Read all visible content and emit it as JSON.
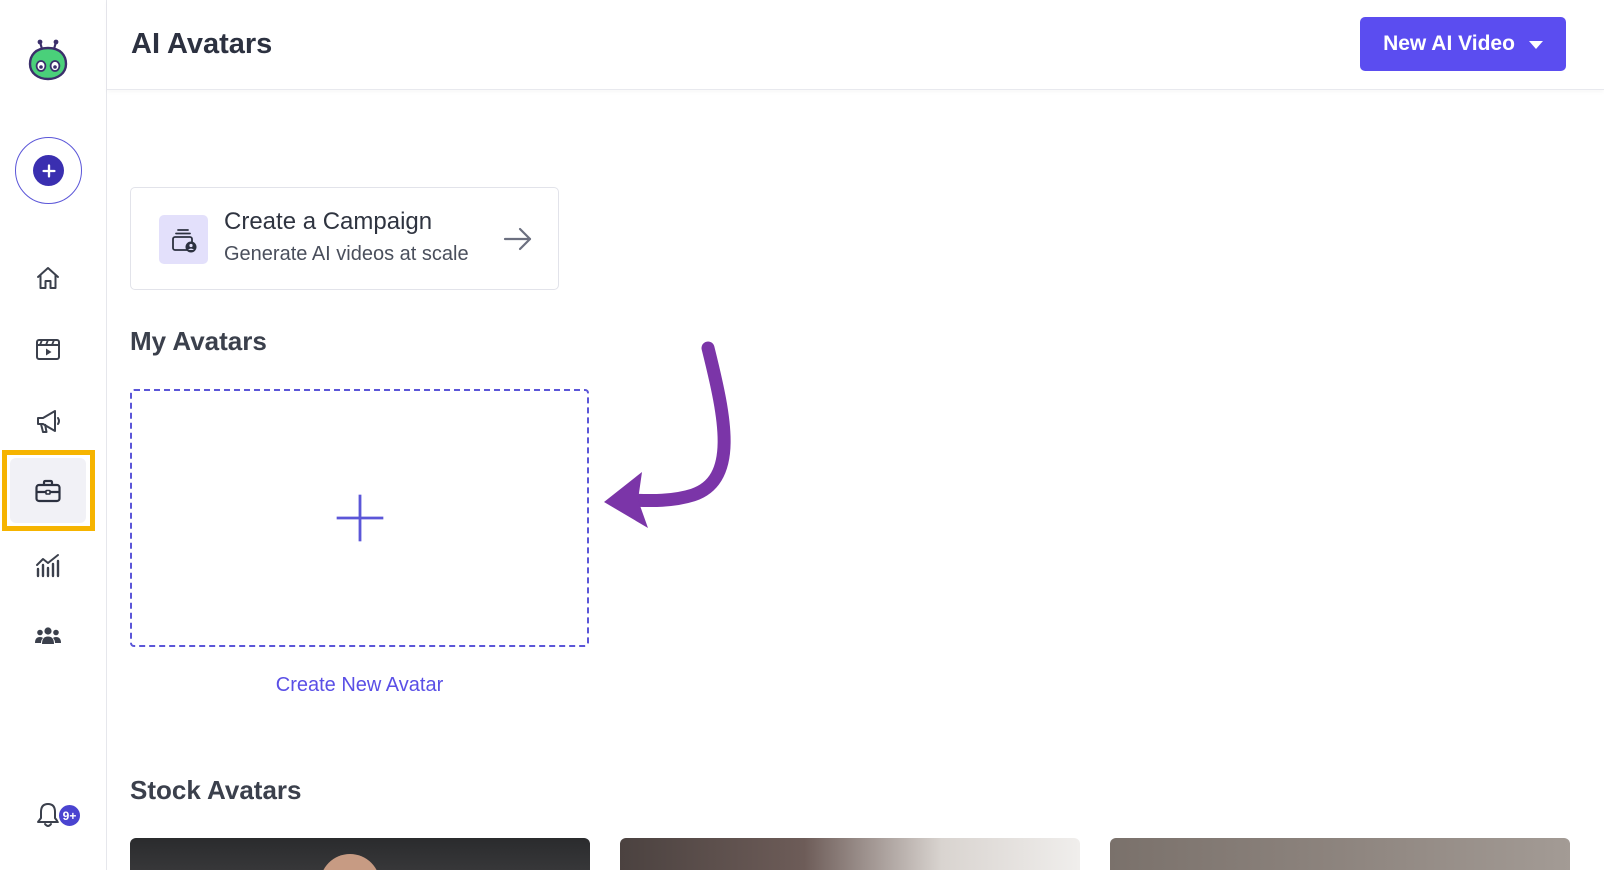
{
  "header": {
    "title": "AI Avatars",
    "new_video_label": "New AI Video"
  },
  "sidebar": {
    "items": [
      {
        "name": "home",
        "icon": "home-icon"
      },
      {
        "name": "videos",
        "icon": "clapperboard-icon"
      },
      {
        "name": "campaigns",
        "icon": "megaphone-icon"
      },
      {
        "name": "avatars",
        "icon": "briefcase-icon",
        "active": true
      },
      {
        "name": "analytics",
        "icon": "analytics-icon"
      },
      {
        "name": "team",
        "icon": "team-icon"
      }
    ],
    "notifications_badge": "9+"
  },
  "campaign_card": {
    "title": "Create a Campaign",
    "subtitle": "Generate AI videos at scale"
  },
  "sections": {
    "my_avatars": "My Avatars",
    "create_new_avatar": "Create New Avatar",
    "stock_avatars": "Stock Avatars"
  },
  "colors": {
    "accent": "#5b4df0",
    "highlight": "#f6b400",
    "annotation_arrow": "#7b35a8"
  }
}
